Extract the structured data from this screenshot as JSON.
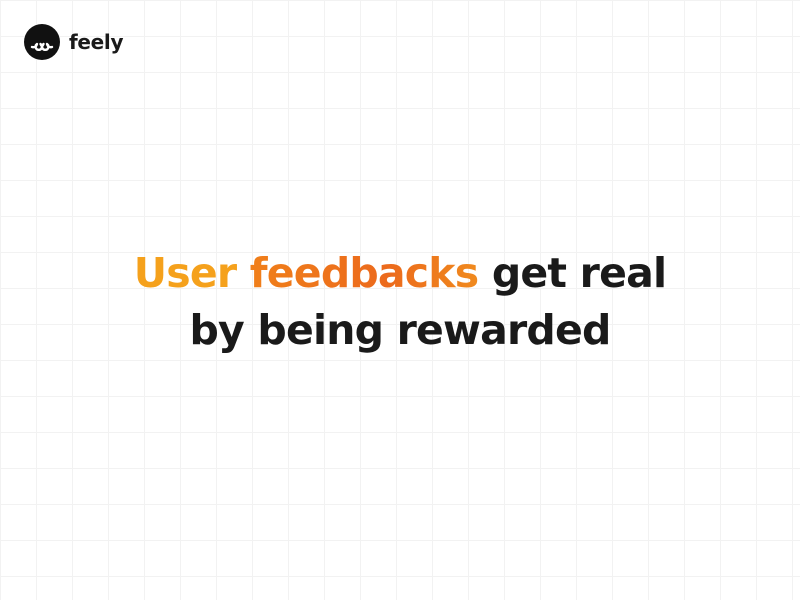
{
  "brand": {
    "logo_icon": "loop-knot-icon",
    "name": "feely"
  },
  "hero": {
    "accent_word_1": "User",
    "accent_word_2": "feedbacks",
    "line1_rest": "get real",
    "line2": "by being rewarded"
  },
  "colors": {
    "accent_light": "#f5a11c",
    "accent_dark": "#ec6a1c",
    "text": "#1a1a1a",
    "logo_bg": "#111111"
  }
}
